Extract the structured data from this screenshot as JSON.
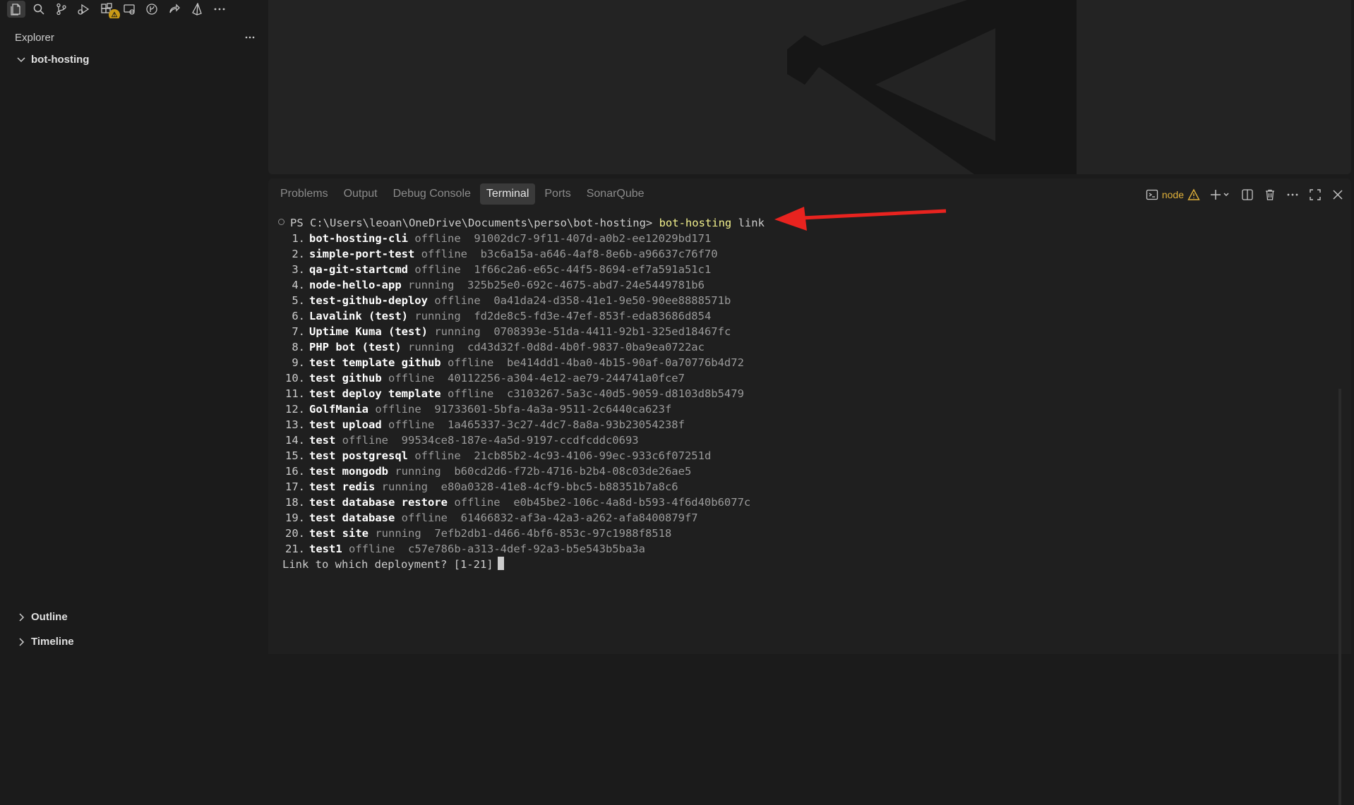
{
  "sidebar": {
    "title": "Explorer",
    "folder": "bot-hosting",
    "outline": "Outline",
    "timeline": "Timeline"
  },
  "activity_icons": [
    "files-icon",
    "search-icon",
    "source-control-icon",
    "run-debug-icon",
    "extensions-icon",
    "remote-explorer-icon",
    "gitlens-icon",
    "live-share-icon",
    "prisma-icon",
    "more-icon"
  ],
  "panel": {
    "tabs": [
      "Problems",
      "Output",
      "Debug Console",
      "Terminal",
      "Ports",
      "SonarQube"
    ],
    "active_tab": "Terminal",
    "terminal_name": "node"
  },
  "terminal": {
    "prompt": "PS C:\\Users\\leoan\\OneDrive\\Documents\\perso\\bot-hosting>",
    "command": "bot-hosting",
    "command_arg": "link",
    "deployments": [
      {
        "n": "1.",
        "name": "bot-hosting-cli",
        "status": "offline",
        "id": "91002dc7-9f11-407d-a0b2-ee12029bd171"
      },
      {
        "n": "2.",
        "name": "simple-port-test",
        "status": "offline",
        "id": "b3c6a15a-a646-4af8-8e6b-a96637c76f70"
      },
      {
        "n": "3.",
        "name": "qa-git-startcmd",
        "status": "offline",
        "id": "1f66c2a6-e65c-44f5-8694-ef7a591a51c1"
      },
      {
        "n": "4.",
        "name": "node-hello-app",
        "status": "running",
        "id": "325b25e0-692c-4675-abd7-24e5449781b6"
      },
      {
        "n": "5.",
        "name": "test-github-deploy",
        "status": "offline",
        "id": "0a41da24-d358-41e1-9e50-90ee8888571b"
      },
      {
        "n": "6.",
        "name": "Lavalink (test)",
        "status": "running",
        "id": "fd2de8c5-fd3e-47ef-853f-eda83686d854"
      },
      {
        "n": "7.",
        "name": "Uptime Kuma (test)",
        "status": "running",
        "id": "0708393e-51da-4411-92b1-325ed18467fc"
      },
      {
        "n": "8.",
        "name": "PHP bot (test)",
        "status": "running",
        "id": "cd43d32f-0d8d-4b0f-9837-0ba9ea0722ac"
      },
      {
        "n": "9.",
        "name": "test template github",
        "status": "offline",
        "id": "be414dd1-4ba0-4b15-90af-0a70776b4d72"
      },
      {
        "n": "10.",
        "name": "test github",
        "status": "offline",
        "id": "40112256-a304-4e12-ae79-244741a0fce7"
      },
      {
        "n": "11.",
        "name": "test deploy template",
        "status": "offline",
        "id": "c3103267-5a3c-40d5-9059-d8103d8b5479"
      },
      {
        "n": "12.",
        "name": "GolfMania",
        "status": "offline",
        "id": "91733601-5bfa-4a3a-9511-2c6440ca623f"
      },
      {
        "n": "13.",
        "name": "test upload",
        "status": "offline",
        "id": "1a465337-3c27-4dc7-8a8a-93b23054238f"
      },
      {
        "n": "14.",
        "name": "test",
        "status": "offline",
        "id": "99534ce8-187e-4a5d-9197-ccdfcddc0693"
      },
      {
        "n": "15.",
        "name": "test postgresql",
        "status": "offline",
        "id": "21cb85b2-4c93-4106-99ec-933c6f07251d"
      },
      {
        "n": "16.",
        "name": "test mongodb",
        "status": "running",
        "id": "b60cd2d6-f72b-4716-b2b4-08c03de26ae5"
      },
      {
        "n": "17.",
        "name": "test redis",
        "status": "running",
        "id": "e80a0328-41e8-4cf9-bbc5-b88351b7a8c6"
      },
      {
        "n": "18.",
        "name": "test database restore",
        "status": "offline",
        "id": "e0b45be2-106c-4a8d-b593-4f6d40b6077c"
      },
      {
        "n": "19.",
        "name": "test database",
        "status": "offline",
        "id": "61466832-af3a-42a3-a262-afa8400879f7"
      },
      {
        "n": "20.",
        "name": "test site",
        "status": "running",
        "id": "7efb2db1-d466-4bf6-853c-97c1988f8518"
      },
      {
        "n": "21.",
        "name": "test1",
        "status": "offline",
        "id": "c57e786b-a313-4def-92a3-b5e543b5ba3a"
      }
    ],
    "question": "Link to which deployment? [1-21]"
  },
  "colors": {
    "accent_warning": "#e0b13a",
    "arrow": "#e8231f",
    "command": "#f1ef8c"
  }
}
